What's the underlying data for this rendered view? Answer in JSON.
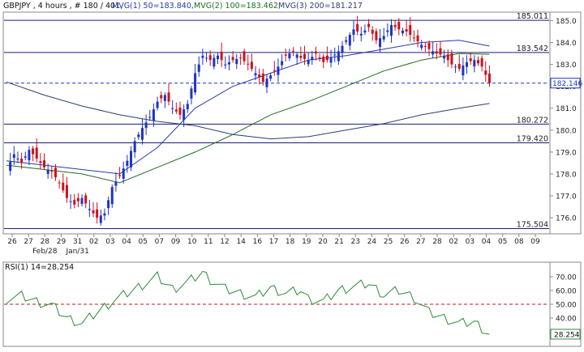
{
  "header": {
    "symbol_text": "GBPJPY , 4 hours , # 180 / 401,",
    "ma1_text": "MVG(1) 50=183.840,",
    "ma2_text": "MVG(2) 100=183.462,",
    "ma3_text": "MVG(3) 200=181.217"
  },
  "colors": {
    "up_candle": "#1c34c8",
    "down_candle": "#d0101a",
    "ma50": "#2a3aa8",
    "ma100": "#1f6b1f",
    "ma200": "#2c3e6e",
    "level_line": "#1c1c7a",
    "rsi_line": "#2e8b3a",
    "rsi_ref": "#c01818",
    "last_price": "#1c34c8",
    "frame": "#8a8a8a"
  },
  "chart_data": [
    {
      "type": "candlestick",
      "title": "GBPJPY , 4 hours , # 180 / 401,",
      "ylim": [
        175.3,
        185.35
      ],
      "y_ticks": [
        176.0,
        177.0,
        178.0,
        179.0,
        180.0,
        181.0,
        182.0,
        183.0,
        184.0,
        185.0
      ],
      "x_tick_labels": [
        "26",
        "27",
        "28",
        "29",
        "31",
        "02",
        "03",
        "04",
        "05",
        "07",
        "09",
        "10",
        "11",
        "12",
        "14",
        "16",
        "17",
        "18",
        "19",
        "20",
        "21",
        "23",
        "24",
        "25",
        "26",
        "27",
        "28",
        "02",
        "03",
        "04",
        "05",
        "08",
        "09"
      ],
      "month_labels": [
        {
          "label": "Jan/31",
          "anchor": "31"
        },
        {
          "label": "Feb/28",
          "anchor": "28"
        }
      ],
      "horizontal_levels": [
        185.011,
        183.542,
        180.272,
        179.42,
        175.504
      ],
      "last_price": 182.146,
      "moving_averages": [
        {
          "name": "MVG(1) 50",
          "last": 183.84
        },
        {
          "name": "MVG(2) 100",
          "last": 183.462
        },
        {
          "name": "MVG(3) 200",
          "last": 181.217
        }
      ],
      "close_path": [
        [
          0,
          178.2
        ],
        [
          2,
          178.9
        ],
        [
          4,
          178.5
        ],
        [
          6,
          179.1
        ],
        [
          8,
          178.7
        ],
        [
          10,
          178.3
        ],
        [
          12,
          178.1
        ],
        [
          14,
          177.6
        ],
        [
          16,
          176.9
        ],
        [
          18,
          176.6
        ],
        [
          20,
          176.9
        ],
        [
          22,
          176.4
        ],
        [
          24,
          176.0
        ],
        [
          26,
          176.2
        ],
        [
          28,
          177.4
        ],
        [
          30,
          177.9
        ],
        [
          32,
          178.6
        ],
        [
          34,
          179.5
        ],
        [
          36,
          180.1
        ],
        [
          38,
          180.6
        ],
        [
          40,
          181.3
        ],
        [
          42,
          181.6
        ],
        [
          44,
          181.0
        ],
        [
          46,
          180.7
        ],
        [
          48,
          181.2
        ],
        [
          50,
          182.6
        ],
        [
          52,
          183.4
        ],
        [
          54,
          183.2
        ],
        [
          56,
          183.4
        ],
        [
          58,
          183.0
        ],
        [
          60,
          183.2
        ],
        [
          62,
          183.3
        ],
        [
          64,
          183.0
        ],
        [
          66,
          182.6
        ],
        [
          68,
          182.2
        ],
        [
          70,
          182.5
        ],
        [
          72,
          182.9
        ],
        [
          74,
          183.4
        ],
        [
          76,
          183.6
        ],
        [
          78,
          183.3
        ],
        [
          80,
          183.2
        ],
        [
          82,
          183.5
        ],
        [
          84,
          183.1
        ],
        [
          86,
          183.3
        ],
        [
          88,
          183.6
        ],
        [
          90,
          184.1
        ],
        [
          92,
          184.6
        ],
        [
          94,
          184.4
        ],
        [
          96,
          184.7
        ],
        [
          98,
          184.1
        ],
        [
          100,
          184.3
        ],
        [
          102,
          184.8
        ],
        [
          104,
          184.6
        ],
        [
          106,
          184.5
        ],
        [
          108,
          184.2
        ],
        [
          110,
          183.9
        ],
        [
          112,
          183.7
        ],
        [
          114,
          183.5
        ],
        [
          116,
          183.4
        ],
        [
          118,
          183.0
        ],
        [
          120,
          182.8
        ],
        [
          122,
          183.1
        ],
        [
          124,
          183.2
        ],
        [
          126,
          182.9
        ],
        [
          128,
          182.146
        ]
      ],
      "ma50_path": [
        [
          0,
          178.6
        ],
        [
          20,
          178.2
        ],
        [
          30,
          178.0
        ],
        [
          40,
          179.2
        ],
        [
          50,
          181.0
        ],
        [
          60,
          182.0
        ],
        [
          70,
          182.6
        ],
        [
          80,
          183.2
        ],
        [
          90,
          183.4
        ],
        [
          100,
          183.7
        ],
        [
          110,
          184.0
        ],
        [
          120,
          184.1
        ],
        [
          128,
          183.84
        ]
      ],
      "ma100_path": [
        [
          0,
          178.4
        ],
        [
          20,
          178.0
        ],
        [
          30,
          177.6
        ],
        [
          40,
          178.3
        ],
        [
          50,
          179.0
        ],
        [
          60,
          179.8
        ],
        [
          70,
          180.7
        ],
        [
          80,
          181.3
        ],
        [
          90,
          182.0
        ],
        [
          100,
          182.7
        ],
        [
          110,
          183.2
        ],
        [
          120,
          183.5
        ],
        [
          128,
          183.462
        ]
      ],
      "ma200_path": [
        [
          0,
          182.2
        ],
        [
          10,
          181.6
        ],
        [
          20,
          181.1
        ],
        [
          30,
          180.7
        ],
        [
          40,
          180.4
        ],
        [
          50,
          180.2
        ],
        [
          60,
          179.8
        ],
        [
          70,
          179.6
        ],
        [
          80,
          179.7
        ],
        [
          90,
          180.0
        ],
        [
          100,
          180.3
        ],
        [
          110,
          180.7
        ],
        [
          120,
          181.0
        ],
        [
          128,
          181.217
        ]
      ]
    },
    {
      "type": "line",
      "title": "RSI(1) 14=28.254",
      "ylim": [
        20,
        80
      ],
      "y_ticks": [
        30.0,
        40.0,
        50.0,
        60.0,
        70.0
      ],
      "reference_line": 50,
      "last_value": 28.254,
      "series": [
        {
          "name": "RSI(1) 14",
          "points": [
            [
              0,
              54
            ],
            [
              4,
              56
            ],
            [
              8,
              52
            ],
            [
              12,
              49
            ],
            [
              16,
              40
            ],
            [
              20,
              36
            ],
            [
              24,
              44
            ],
            [
              28,
              52
            ],
            [
              32,
              58
            ],
            [
              36,
              64
            ],
            [
              40,
              70
            ],
            [
              44,
              61
            ],
            [
              48,
              66
            ],
            [
              52,
              73
            ],
            [
              54,
              68
            ],
            [
              58,
              61
            ],
            [
              62,
              58
            ],
            [
              66,
              55
            ],
            [
              70,
              62
            ],
            [
              74,
              58
            ],
            [
              78,
              60
            ],
            [
              80,
              54
            ],
            [
              84,
              52
            ],
            [
              88,
              60
            ],
            [
              92,
              63
            ],
            [
              96,
              65
            ],
            [
              100,
              57
            ],
            [
              104,
              60
            ],
            [
              108,
              55
            ],
            [
              112,
              44
            ],
            [
              116,
              40
            ],
            [
              120,
              36
            ],
            [
              124,
              37
            ],
            [
              128,
              28.254
            ]
          ]
        }
      ]
    }
  ]
}
